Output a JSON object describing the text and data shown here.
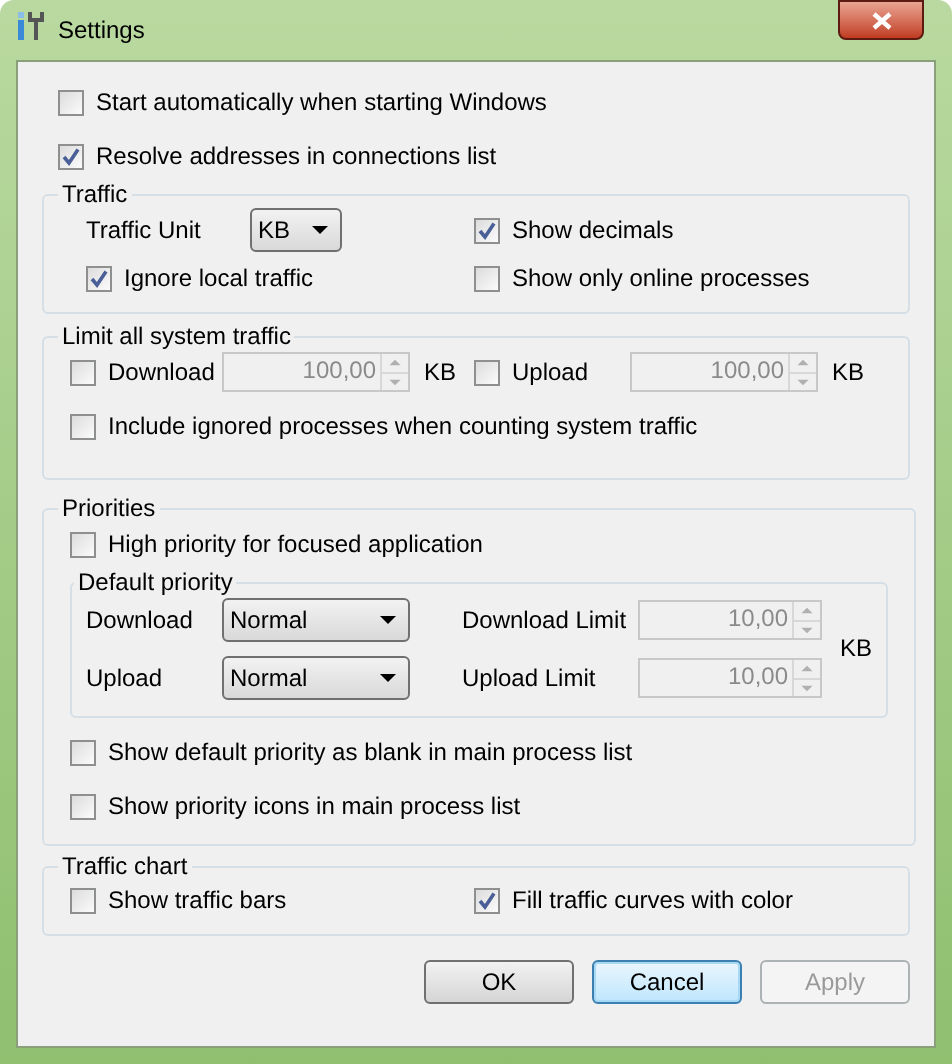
{
  "window": {
    "title": "Settings"
  },
  "general": [
    {
      "label": "Start automatically when starting Windows",
      "checked": false
    },
    {
      "label": "Resolve addresses in connections list",
      "checked": true
    }
  ],
  "traffic": {
    "title": "Traffic",
    "unit_label": "Traffic Unit",
    "unit_value": "KB",
    "ignore_local": {
      "label": "Ignore local traffic",
      "checked": true
    },
    "show_decimals": {
      "label": "Show decimals",
      "checked": true
    },
    "only_online": {
      "label": "Show only online processes",
      "checked": false
    }
  },
  "limit": {
    "title": "Limit all system traffic",
    "fields": [
      {
        "label": "Download",
        "checked": false,
        "value": "100,00",
        "disabled": true,
        "unit": "KB"
      },
      {
        "label": "Upload",
        "checked": false,
        "value": "100,00",
        "disabled": true,
        "unit": "KB"
      }
    ],
    "include_ignored": {
      "label": "Include ignored processes when counting system traffic",
      "checked": false
    }
  },
  "priorities": {
    "title": "Priorities",
    "high_priority": {
      "label": "High priority for focused application",
      "checked": false
    },
    "default_priority": {
      "title": "Default priority",
      "unit": "KB",
      "rows": [
        {
          "label": "Download",
          "value": "Normal",
          "limit_label": "Download Limit",
          "limit_value": "10,00",
          "disabled": true
        },
        {
          "label": "Upload",
          "value": "Normal",
          "limit_label": "Upload Limit",
          "limit_value": "10,00",
          "disabled": true
        }
      ]
    },
    "options": [
      {
        "label": "Show default priority as blank in main process list",
        "checked": false
      },
      {
        "label": "Show priority icons in main process list",
        "checked": false
      }
    ]
  },
  "traffic_chart": {
    "title": "Traffic chart",
    "options": [
      {
        "label": "Show traffic bars",
        "checked": false
      },
      {
        "label": "Fill traffic curves with color",
        "checked": true
      }
    ]
  },
  "buttons": [
    {
      "label": "OK",
      "disabled": false,
      "focused": false
    },
    {
      "label": "Cancel",
      "disabled": false,
      "focused": true
    },
    {
      "label": "Apply",
      "disabled": true,
      "focused": false
    }
  ]
}
